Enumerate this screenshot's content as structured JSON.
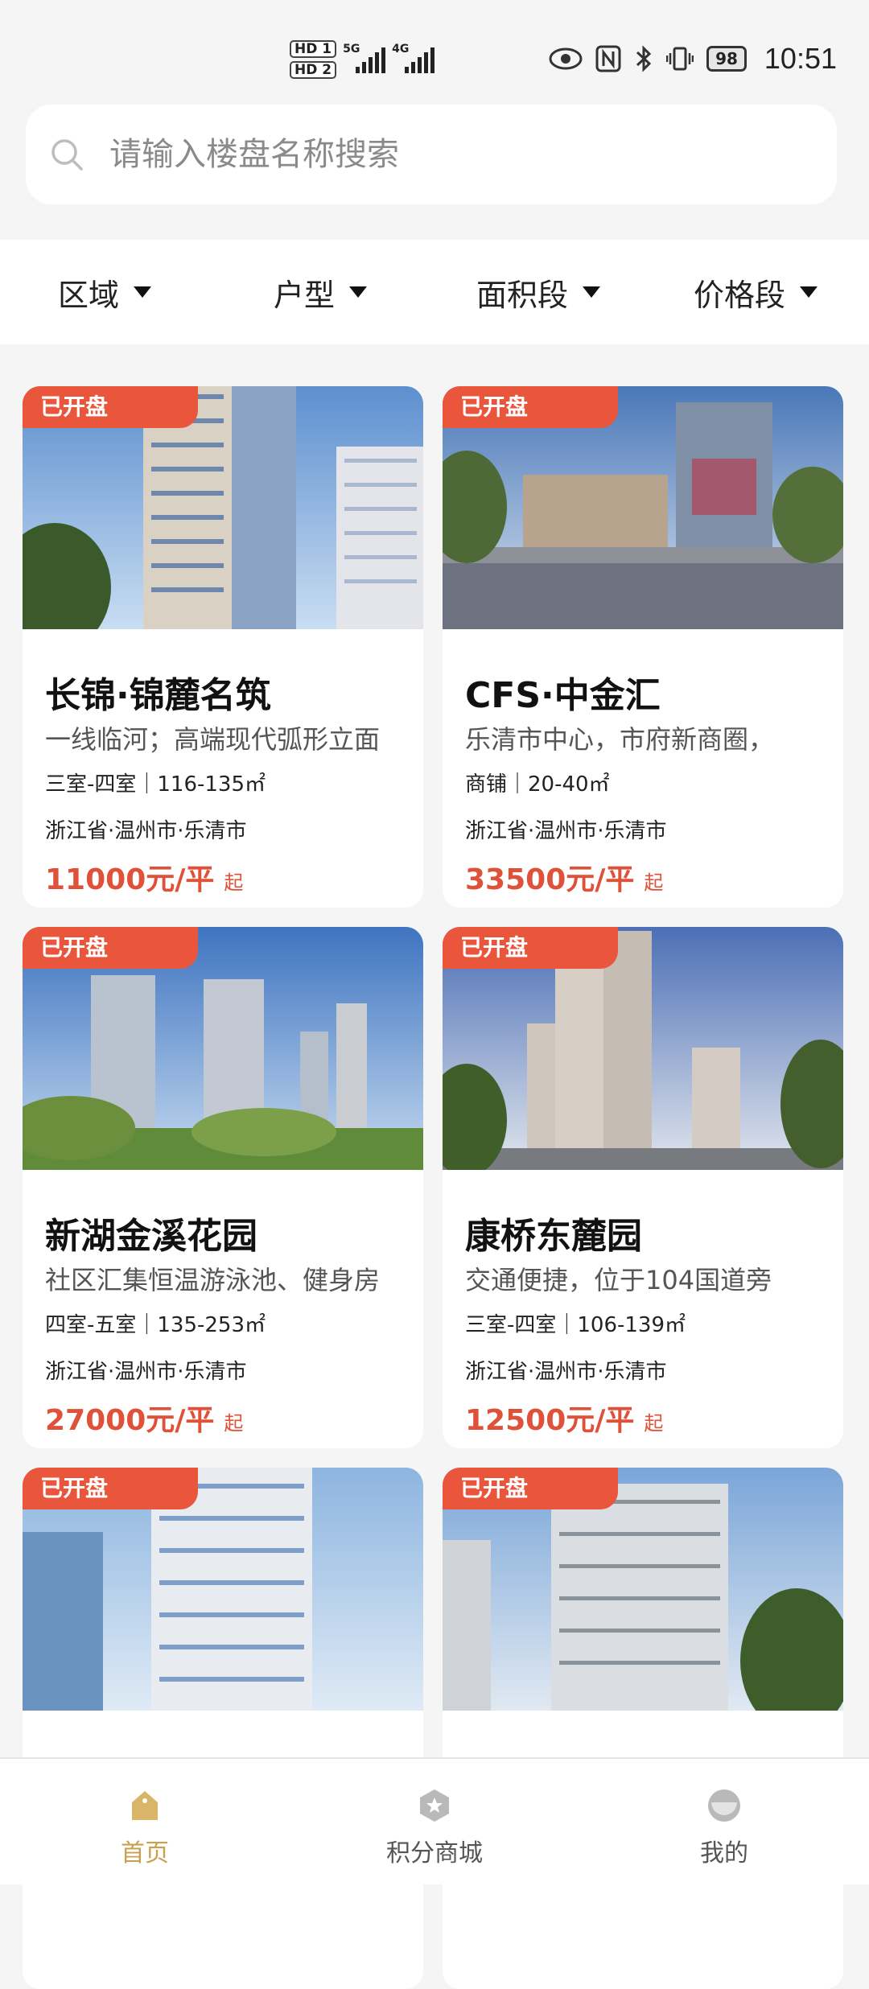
{
  "status_bar": {
    "sim1": "HD 1",
    "sim2": "HD 2",
    "net1": "5G",
    "net2": "4G",
    "battery": "98",
    "time": "10:51"
  },
  "search": {
    "placeholder": "请输入楼盘名称搜索"
  },
  "filters": [
    {
      "label": "区域"
    },
    {
      "label": "户型"
    },
    {
      "label": "面积段"
    },
    {
      "label": "价格段"
    }
  ],
  "listings": [
    {
      "badge": "已开盘",
      "title": "长锦·锦麓名筑",
      "desc": "一线临河；高端现代弧形立面",
      "spec": "三室-四室｜116-135㎡",
      "location": "浙江省·温州市·乐清市",
      "price": "11000元/平",
      "price_suffix": "起"
    },
    {
      "badge": "已开盘",
      "title": "CFS·中金汇",
      "desc": "乐清市中心，市府新商圈，",
      "spec": "商铺｜20-40㎡",
      "location": "浙江省·温州市·乐清市",
      "price": "33500元/平",
      "price_suffix": "起"
    },
    {
      "badge": "已开盘",
      "title": "新湖金溪花园",
      "desc": "社区汇集恒温游泳池、健身房",
      "spec": "四室-五室｜135-253㎡",
      "location": "浙江省·温州市·乐清市",
      "price": "27000元/平",
      "price_suffix": "起"
    },
    {
      "badge": "已开盘",
      "title": "康桥东麓园",
      "desc": "交通便捷，位于104国道旁",
      "spec": "三室-四室｜106-139㎡",
      "location": "浙江省·温州市·乐清市",
      "price": "12500元/平",
      "price_suffix": "起"
    },
    {
      "badge": "已开盘"
    },
    {
      "badge": "已开盘"
    }
  ],
  "tabs": [
    {
      "label": "首页",
      "active": true
    },
    {
      "label": "积分商城",
      "active": false
    },
    {
      "label": "我的",
      "active": false
    }
  ],
  "colors": {
    "accent": "#e9563c",
    "price": "#e0513a",
    "active_tab": "#c9a14e"
  }
}
